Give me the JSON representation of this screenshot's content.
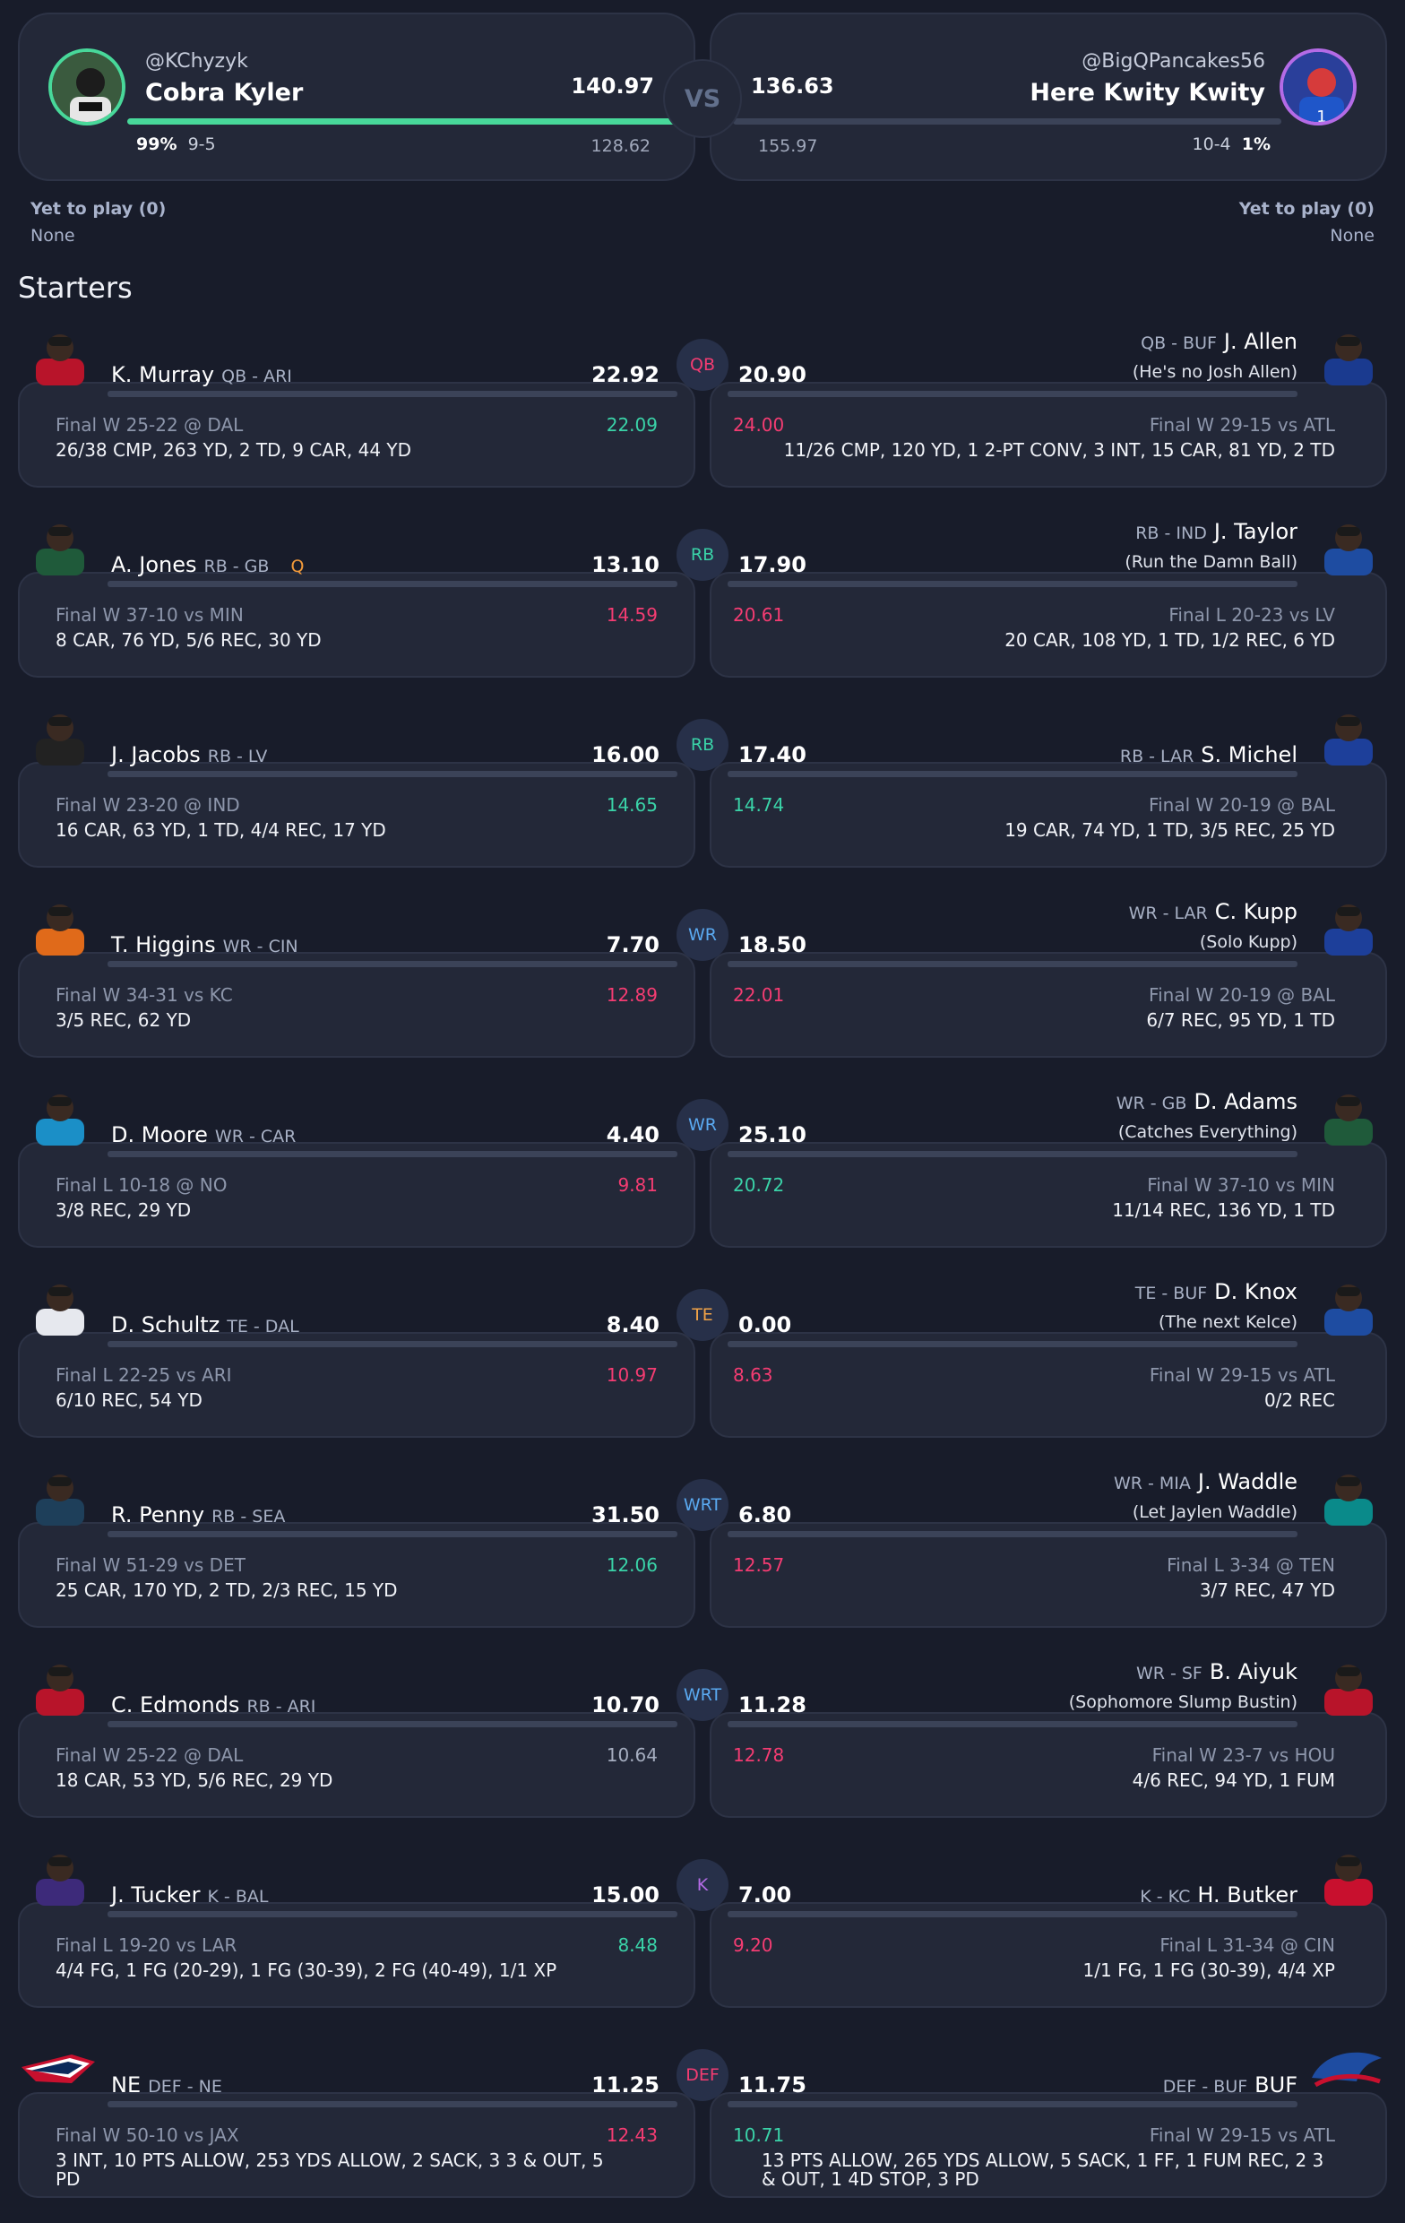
{
  "header": {
    "left": {
      "handle": "@KChyzyk",
      "name": "Cobra Kyler",
      "score": "140.97",
      "win_pct": "99%",
      "record": "9-5",
      "projected": "128.62"
    },
    "vs": "VS",
    "right": {
      "handle": "@BigQPancakes56",
      "name": "Here Kwity Kwity",
      "score": "136.63",
      "win_pct": "1%",
      "record": "10-4",
      "projected": "155.97"
    }
  },
  "yet_to_play": {
    "left": {
      "label": "Yet to play (0)",
      "value": "None"
    },
    "right": {
      "label": "Yet to play (0)",
      "value": "None"
    }
  },
  "section_title": "Starters",
  "matchups": [
    {
      "pos": "QB",
      "pos_color": "#f43c72",
      "left": {
        "name": "K. Murray",
        "posteam": "QB - ARI",
        "injury": "",
        "score": "22.92",
        "game": "Final W 25-22 @ DAL",
        "proj": "22.09",
        "proj_color": "#3ad3a8",
        "stats": "26/38 CMP, 263 YD, 2 TD, 9 CAR, 44 YD"
      },
      "right": {
        "name": "J. Allen",
        "posteam": "QB - BUF",
        "tag": "(He's no Josh Allen)",
        "score": "20.90",
        "game": "Final W 29-15 vs ATL",
        "proj": "24.00",
        "proj_color": "#f43c72",
        "stats": "11/26 CMP, 120 YD, 1 2-PT CONV, 3 INT, 15 CAR, 81 YD, 2 TD"
      }
    },
    {
      "pos": "RB",
      "pos_color": "#3ad3a8",
      "left": {
        "name": "A. Jones",
        "posteam": "RB - GB",
        "injury": "Q",
        "score": "13.10",
        "game": "Final W 37-10 vs MIN",
        "proj": "14.59",
        "proj_color": "#f43c72",
        "stats": "8 CAR, 76 YD, 5/6 REC, 30 YD"
      },
      "right": {
        "name": "J. Taylor",
        "posteam": "RB - IND",
        "tag": "(Run the Damn Ball)",
        "score": "17.90",
        "game": "Final L 20-23 vs LV",
        "proj": "20.61",
        "proj_color": "#f43c72",
        "stats": "20 CAR, 108 YD, 1 TD, 1/2 REC, 6 YD"
      }
    },
    {
      "pos": "RB",
      "pos_color": "#3ad3a8",
      "left": {
        "name": "J. Jacobs",
        "posteam": "RB - LV",
        "injury": "",
        "score": "16.00",
        "game": "Final W 23-20 @ IND",
        "proj": "14.65",
        "proj_color": "#3ad3a8",
        "stats": "16 CAR, 63 YD, 1 TD, 4/4 REC, 17 YD"
      },
      "right": {
        "name": "S. Michel",
        "posteam": "RB - LAR",
        "tag": "",
        "score": "17.40",
        "game": "Final W 20-19 @ BAL",
        "proj": "14.74",
        "proj_color": "#3ad3a8",
        "stats": "19 CAR, 74 YD, 1 TD, 3/5 REC, 25 YD"
      }
    },
    {
      "pos": "WR",
      "pos_color": "#5aa9f0",
      "left": {
        "name": "T. Higgins",
        "posteam": "WR - CIN",
        "injury": "",
        "score": "7.70",
        "game": "Final W 34-31 vs KC",
        "proj": "12.89",
        "proj_color": "#f43c72",
        "stats": "3/5 REC, 62 YD"
      },
      "right": {
        "name": "C. Kupp",
        "posteam": "WR - LAR",
        "tag": "(Solo Kupp)",
        "score": "18.50",
        "game": "Final W 20-19 @ BAL",
        "proj": "22.01",
        "proj_color": "#f43c72",
        "stats": "6/7 REC, 95 YD, 1 TD"
      }
    },
    {
      "pos": "WR",
      "pos_color": "#5aa9f0",
      "left": {
        "name": "D. Moore",
        "posteam": "WR - CAR",
        "injury": "",
        "score": "4.40",
        "game": "Final L 10-18 @ NO",
        "proj": "9.81",
        "proj_color": "#f43c72",
        "stats": "3/8 REC, 29 YD"
      },
      "right": {
        "name": "D. Adams",
        "posteam": "WR - GB",
        "tag": "(Catches Everything)",
        "score": "25.10",
        "game": "Final W 37-10 vs MIN",
        "proj": "20.72",
        "proj_color": "#3ad3a8",
        "stats": "11/14 REC, 136 YD, 1 TD"
      }
    },
    {
      "pos": "TE",
      "pos_color": "#f2a347",
      "left": {
        "name": "D. Schultz",
        "posteam": "TE - DAL",
        "injury": "",
        "score": "8.40",
        "game": "Final L 22-25 vs ARI",
        "proj": "10.97",
        "proj_color": "#f43c72",
        "stats": "6/10 REC, 54 YD"
      },
      "right": {
        "name": "D. Knox",
        "posteam": "TE - BUF",
        "tag": "(The next Kelce)",
        "score": "0.00",
        "game": "Final W 29-15 vs ATL",
        "proj": "8.63",
        "proj_color": "#f43c72",
        "stats": "0/2 REC"
      }
    },
    {
      "pos": "WRT",
      "pos_color": "#5aa9f0",
      "left": {
        "name": "R. Penny",
        "posteam": "RB - SEA",
        "injury": "",
        "score": "31.50",
        "game": "Final W 51-29 vs DET",
        "proj": "12.06",
        "proj_color": "#3ad3a8",
        "stats": "25 CAR, 170 YD, 2 TD, 2/3 REC, 15 YD"
      },
      "right": {
        "name": "J. Waddle",
        "posteam": "WR - MIA",
        "tag": "(Let Jaylen Waddle)",
        "score": "6.80",
        "game": "Final L 3-34 @ TEN",
        "proj": "12.57",
        "proj_color": "#f43c72",
        "stats": "3/7 REC, 47 YD"
      }
    },
    {
      "pos": "WRT",
      "pos_color": "#5aa9f0",
      "left": {
        "name": "C. Edmonds",
        "posteam": "RB - ARI",
        "injury": "",
        "score": "10.70",
        "game": "Final W 25-22 @ DAL",
        "proj": "10.64",
        "proj_color": "#a6aec0",
        "stats": "18 CAR, 53 YD, 5/6 REC, 29 YD"
      },
      "right": {
        "name": "B. Aiyuk",
        "posteam": "WR - SF",
        "tag": "(Sophomore Slump Bustin)",
        "score": "11.28",
        "game": "Final W 23-7 vs HOU",
        "proj": "12.78",
        "proj_color": "#f43c72",
        "stats": "4/6 REC, 94 YD, 1 FUM"
      }
    },
    {
      "pos": "K",
      "pos_color": "#b46be6",
      "left": {
        "name": "J. Tucker",
        "posteam": "K - BAL",
        "injury": "",
        "score": "15.00",
        "game": "Final L 19-20 vs LAR",
        "proj": "8.48",
        "proj_color": "#3ad3a8",
        "stats": "4/4 FG, 1 FG (20-29), 1 FG (30-39), 2 FG (40-49), 1/1 XP"
      },
      "right": {
        "name": "H. Butker",
        "posteam": "K - KC",
        "tag": "",
        "score": "7.00",
        "game": "Final L 31-34 @ CIN",
        "proj": "9.20",
        "proj_color": "#f43c72",
        "stats": "1/1 FG, 1 FG (30-39), 4/4 XP"
      }
    },
    {
      "pos": "DEF",
      "pos_color": "#f43c72",
      "left": {
        "name": "NE",
        "posteam": "DEF - NE",
        "injury": "",
        "score": "11.25",
        "game": "Final W 50-10 vs JAX",
        "proj": "12.43",
        "proj_color": "#f43c72",
        "stats": "3 INT, 10 PTS ALLOW, 253 YDS ALLOW, 2 SACK, 3 3 & OUT, 5 PD"
      },
      "right": {
        "name": "BUF",
        "posteam": "DEF - BUF",
        "tag": "",
        "score": "11.75",
        "game": "Final W 29-15 vs ATL",
        "proj": "10.71",
        "proj_color": "#3ad3a8",
        "stats": "13 PTS ALLOW, 265 YDS ALLOW, 5 SACK, 1 FF, 1 FUM REC, 2 3 & OUT, 1 4D STOP, 3 PD"
      }
    }
  ]
}
